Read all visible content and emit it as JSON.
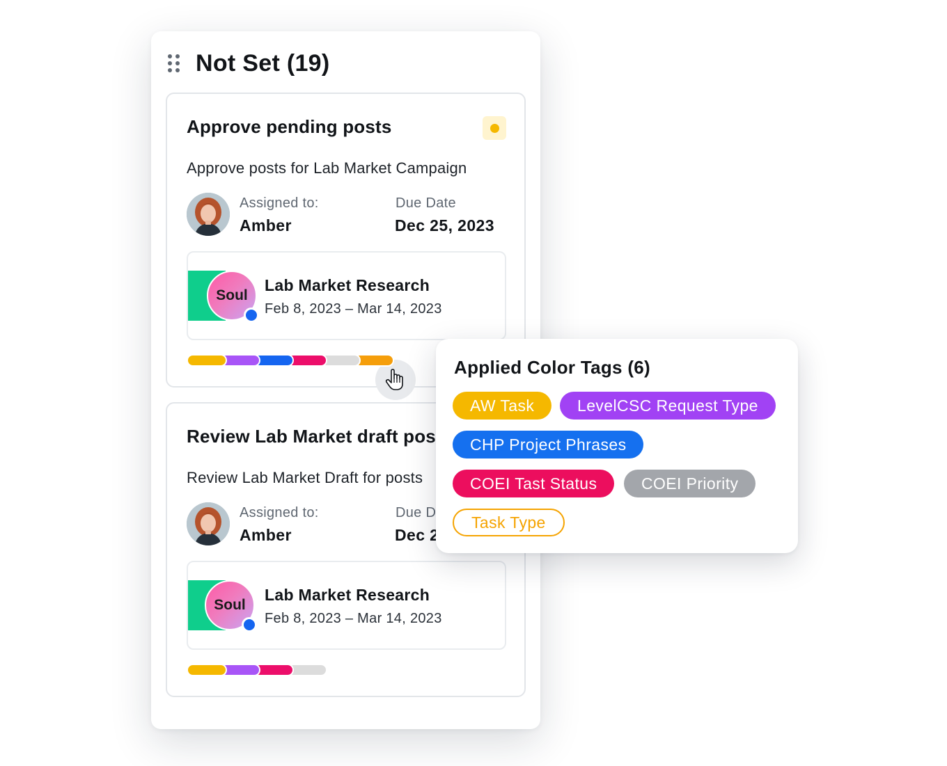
{
  "column": {
    "title": "Not Set (19)",
    "cards": [
      {
        "title": "Approve pending posts",
        "description": "Approve posts for Lab Market Campaign",
        "assigned_label": "Assigned to:",
        "assigned_name": "Amber",
        "due_label": "Due Date",
        "due_value": "Dec 25, 2023",
        "priority_color": "#f5b800",
        "campaign": {
          "badge": "Soul",
          "title": "Lab Market Research",
          "dates": "Feb 8, 2023 – Mar 14, 2023"
        },
        "tag_colors": [
          "#f5b800",
          "#a855f7",
          "#1565f0",
          "#ec0e6a",
          "#dcdcdc",
          "#f59e0b"
        ]
      },
      {
        "title": "Review Lab Market draft posts",
        "description": "Review Lab Market Draft for posts",
        "assigned_label": "Assigned to:",
        "assigned_name": "Amber",
        "due_label": "Due Date",
        "due_value": "Dec 25, 2023",
        "campaign": {
          "badge": "Soul",
          "title": "Lab Market Research",
          "dates": "Feb 8, 2023 – Mar 14, 2023"
        },
        "tag_colors": [
          "#f5b800",
          "#a855f7",
          "#ec0e6a",
          "#dcdcdc"
        ]
      }
    ]
  },
  "popover": {
    "title": "Applied Color Tags (6)",
    "tags": [
      {
        "label": "AW Task",
        "color": "#f5b800",
        "style": "filled"
      },
      {
        "label": "LevelCSC Request Type",
        "color": "#a142f4",
        "style": "filled"
      },
      {
        "label": "CHP Project Phrases",
        "color": "#1570ef",
        "style": "filled"
      },
      {
        "label": "COEI Tast Status",
        "color": "#ec0e5e",
        "style": "filled"
      },
      {
        "label": "COEI Priority",
        "color": "#a3a6ab",
        "style": "filled"
      },
      {
        "label": "Task Type",
        "color": "#f5a300",
        "style": "outline"
      }
    ]
  },
  "icons": {
    "drag": "drag-handle-icon",
    "cursor": "hand-pointer-icon",
    "priority": "priority-dot-icon"
  }
}
